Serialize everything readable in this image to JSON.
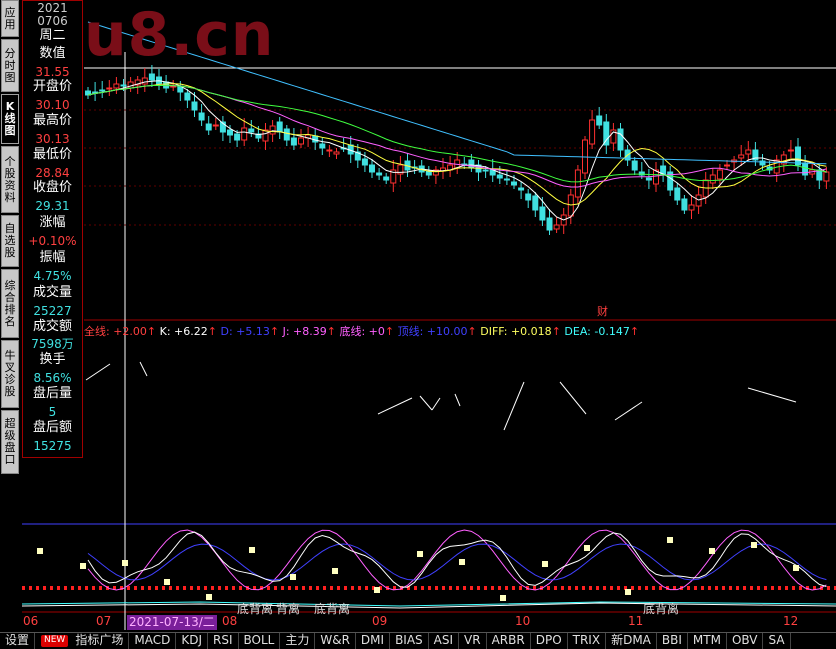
{
  "vtabs": [
    {
      "label": "应用",
      "active": false
    },
    {
      "label": "分时图",
      "active": false
    },
    {
      "label": "K线图",
      "active": true
    },
    {
      "label": "个股资料",
      "active": false
    },
    {
      "label": "自选股",
      "active": false
    },
    {
      "label": "综合排名",
      "active": false
    },
    {
      "label": "牛叉诊股",
      "active": false
    },
    {
      "label": "超级盘口",
      "active": false
    }
  ],
  "info": {
    "year": "2021",
    "date": "0706",
    "weekday": "周二",
    "value_label": "数值",
    "value": "31.55",
    "open_label": "开盘价",
    "open": "30.10",
    "high_label": "最高价",
    "high": "30.13",
    "low_label": "最低价",
    "low": "28.84",
    "close_label": "收盘价",
    "close": "29.31",
    "change_label": "涨幅",
    "change": "+0.10%",
    "amp_label": "振幅",
    "amp": "4.75%",
    "vol_label": "成交量",
    "vol": "25227",
    "amt_label": "成交额",
    "amt": "7598万",
    "turn_label": "换手",
    "turn": "8.56%",
    "after_vol_label": "盘后量",
    "after_vol": "5",
    "after_amt_label": "盘后额",
    "after_amt": "15275"
  },
  "watermark": "gu8.cn",
  "fin_marker": "财",
  "indicator_legend": [
    {
      "text": "全线: +2.00",
      "color": "#ff4040"
    },
    {
      "text": "K: +6.22",
      "color": "#ffffff"
    },
    {
      "text": "D: +5.13",
      "color": "#4040ff"
    },
    {
      "text": "J: +8.39",
      "color": "#ff60ff"
    },
    {
      "text": "底线: +0",
      "color": "#ff60ff"
    },
    {
      "text": "顶线: +10.00",
      "color": "#4040ff"
    },
    {
      "text": "DIFF: +0.018",
      "color": "#ffff60"
    },
    {
      "text": "DEA: -0.147",
      "color": "#40ffff"
    }
  ],
  "divergence_labels": [
    "底背离",
    "背离",
    "底背离",
    "底背离"
  ],
  "months": [
    "06",
    "07",
    "08",
    "09",
    "10",
    "11",
    "12"
  ],
  "date_tag": "2021-07-13/二",
  "bottom_tabs": [
    "设置",
    "NEW",
    "指标广场",
    "MACD",
    "KDJ",
    "RSI",
    "BOLL",
    "主力",
    "W&R",
    "DMI",
    "BIAS",
    "ASI",
    "VR",
    "ARBR",
    "DPO",
    "TRIX",
    "新DMA",
    "BBI",
    "MTM",
    "OBV",
    "SA"
  ],
  "colors": {
    "up": "#ff3030",
    "down": "#40e0e0",
    "ma5": "#ffffff",
    "ma10": "#ffff40",
    "ma20": "#ff60ff",
    "ma30": "#40ff40",
    "ma60": "#40c0ff"
  }
}
